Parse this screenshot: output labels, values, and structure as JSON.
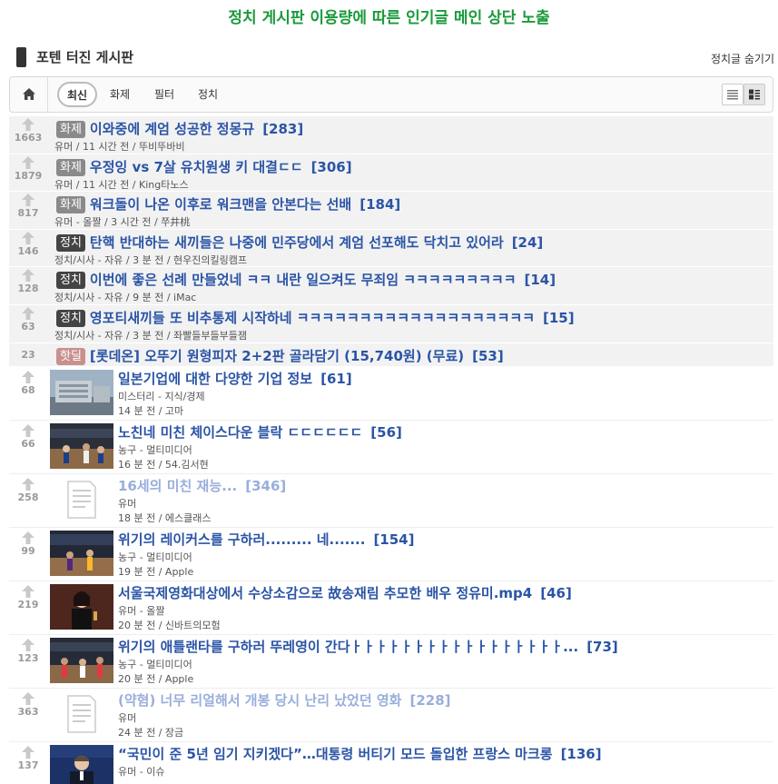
{
  "banner": "정치 게시판 이용량에 따른 인기글 메인 상단 노출",
  "board": {
    "title": "포텐 터진 게시판",
    "hide_politics": "정치글 숨기기"
  },
  "tabs": [
    {
      "label": "최신",
      "active": true
    },
    {
      "label": "화제"
    },
    {
      "label": "필터"
    },
    {
      "label": "정치"
    }
  ],
  "view_modes": [
    "list-view-icon",
    "card-view-icon"
  ],
  "colors": {
    "link": "#2a54a6",
    "visited": "#99aedb",
    "banner": "#1a9a3a"
  },
  "sticky_posts": [
    {
      "votes": "1663",
      "badge": "화제",
      "badge_type": "hwa",
      "title": "이와중에 계엄 성공한 정몽규",
      "comments": "[283]",
      "meta": "유머 / 11 시간 전 / 뚜비뚜바비"
    },
    {
      "votes": "1879",
      "badge": "화제",
      "badge_type": "hwa",
      "title": "우정잉 vs 7살 유치원생 키 대결ㄷㄷ",
      "comments": "[306]",
      "meta": "유머 / 11 시간 전 / King타노스"
    },
    {
      "votes": "817",
      "badge": "화제",
      "badge_type": "hwa",
      "title": "워크돌이 나온 이후로 워크맨을 안본다는 선배",
      "comments": "[184]",
      "meta": "유머 - 올짤 / 3 시간 전 / 쭈井桃"
    },
    {
      "votes": "146",
      "badge": "정치",
      "badge_type": "jeong",
      "title": "탄핵 반대하는 새끼들은 나중에 민주당에서 계엄 선포해도 닥치고 있어라",
      "comments": "[24]",
      "meta": "정치/시사 - 자유 / 3 분 전 / 현우진의킬링캠프"
    },
    {
      "votes": "128",
      "badge": "정치",
      "badge_type": "jeong",
      "title": "이번에 좋은 선례 만들었네 ㅋㅋ 내란 일으켜도 무죄임 ㅋㅋㅋㅋㅋㅋㅋㅋㅋ",
      "comments": "[14]",
      "meta": "정치/시사 - 자유 / 9 분 전 / iMac"
    },
    {
      "votes": "63",
      "badge": "정치",
      "badge_type": "jeong",
      "title": "영포티새끼들 또 비추통제 시작하네 ㅋㅋㅋㅋㅋㅋㅋㅋㅋㅋㅋㅋㅋㅋㅋㅋㅋㅋㅋ",
      "comments": "[15]",
      "meta": "정치/시사 - 자유 / 3 분 전 / 좌빨들부들부들잼"
    }
  ],
  "hot_deal": {
    "votes": "23",
    "badge": "핫딜",
    "title": "[롯데온] 오뚜기 원형피자 2+2판 골라담기 (15,740원) (무료)",
    "comments": "[53]"
  },
  "posts": [
    {
      "votes": "68",
      "title": "일본기업에 대한 다양한 기업 정보",
      "comments": "[61]",
      "category": "미스터리 - 지식/경제",
      "meta": "14 분 전 / 고마",
      "image": "building",
      "visited": false
    },
    {
      "votes": "66",
      "title": "노친네 미친 체이스다운 블락 ㄷㄷㄷㄷㄷㄷ",
      "comments": "[56]",
      "category": "농구 - 멀티미디어",
      "meta": "16 분 전 / 54.김서현",
      "image": "basketball",
      "visited": false
    },
    {
      "votes": "258",
      "title": "16세의 미친 재능...",
      "comments": "[346]",
      "category": "유머",
      "meta": "18 분 전 / 에스클래스",
      "image": "document",
      "visited": true
    },
    {
      "votes": "99",
      "title": "위기의 레이커스를 구하러......... 네.......",
      "comments": "[154]",
      "category": "농구 - 멀티미디어",
      "meta": "19 분 전 / Apple",
      "image": "basketball",
      "visited": false
    },
    {
      "votes": "219",
      "title": "서울국제영화대상에서 수상소감으로 故송재림 추모한 배우 정유미.mp4",
      "comments": "[46]",
      "category": "유머 - 올짤",
      "meta": "20 분 전 / 신바트의모험",
      "image": "stage",
      "visited": false
    },
    {
      "votes": "123",
      "title": "위기의 애틀랜타를 구하러 뚜레영이 간다ㅏㅏㅏㅏㅏㅏㅏㅏㅏㅏㅏㅏㅏㅏㅏㅏㅏ...",
      "comments": "[73]",
      "category": "농구 - 멀티미디어",
      "meta": "20 분 전 / Apple",
      "image": "basketball",
      "visited": false
    },
    {
      "votes": "363",
      "title": "(약혐) 너무 리얼해서 개봉 당시 난리 났었던 영화",
      "comments": "[228]",
      "category": "유머",
      "meta": "24 분 전 / 장금",
      "image": "document",
      "visited": true
    },
    {
      "votes": "137",
      "title": "“국민이 준 5년 임기 지키겠다”…대통령 버티기 모드 돌입한 프랑스 마크롱",
      "comments": "[136]",
      "category": "유머 - 이슈",
      "meta": "",
      "image": "news",
      "visited": false
    }
  ]
}
